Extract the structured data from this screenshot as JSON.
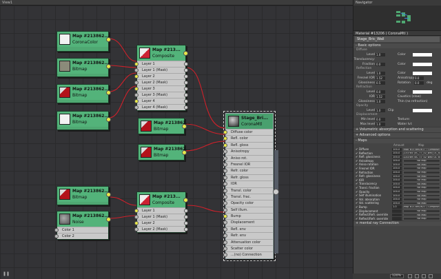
{
  "window": {
    "title": "View1"
  },
  "colors": {
    "node_bg": "#4fa872",
    "slot_bg": "#c9c9c9",
    "wire": "#d0202a",
    "port": "#e8e84a",
    "canvas": "#333336",
    "panel": "#444444"
  },
  "nodes": {
    "map_cc": {
      "name": "Map #213862...",
      "type": "CoronaColor"
    },
    "map_bmp1": {
      "name": "Map #213862...",
      "type": "Bitmap"
    },
    "map_bmp2": {
      "name": "Map #213862...",
      "type": "Bitmap"
    },
    "map_bmp3": {
      "name": "Map #213862...",
      "type": "Bitmap"
    },
    "composite1": {
      "name": "Map #213...",
      "type": "Composite",
      "slots": [
        "Layer 1",
        "Layer 1 (Mask)",
        "Layer 2",
        "Layer 2 (Mask)",
        "Layer 3",
        "Layer 3 (Mask)",
        "Layer 4",
        "Layer 4 (Mask)"
      ]
    },
    "map_bmp4": {
      "name": "Map #213862...",
      "type": "Bitmap"
    },
    "map_bmp5": {
      "name": "Map #213862...",
      "type": "Bitmap"
    },
    "material": {
      "name": "Stage_Bri...",
      "type": "CoronaMtl",
      "slots": [
        "Diffuse color",
        "Refl. color",
        "Refl. gloss",
        "Anisotropy",
        "Aniso rot.",
        "Fresnel IOR",
        "Refr. color",
        "Refr. gloss",
        "IOR",
        "Transl. color",
        "Transl. frac.",
        "Opacity color",
        "Self illum.",
        "Bump",
        "Displacement",
        "Refl. env",
        "Refr. env",
        "Attenuation color",
        "Scatter color",
        "...(no) Connection"
      ]
    },
    "map_bmp6": {
      "name": "Map #213862...",
      "type": "Bitmap"
    },
    "noise": {
      "name": "Map #213862...",
      "type": "Noise",
      "slots": [
        "Color 1",
        "Color 2"
      ]
    },
    "composite2": {
      "name": "Map #213...",
      "type": "Composite",
      "slots": [
        "Layer 1",
        "Layer 1 (Mask)",
        "Layer 2",
        "Layer 2 (Mask)"
      ]
    }
  },
  "navigator": {
    "title": "Navigator"
  },
  "params": {
    "title": "Material #13206  ( CoronaMtl )",
    "mat_name": "Stage_Bric_Wall",
    "basic_options": "Basic options",
    "diffuse": {
      "label": "Diffuse",
      "level_lbl": "Level",
      "level": "1.0",
      "color_lbl": "Color",
      "transl_lbl": "Translucency:",
      "fraction_lbl": "Fraction",
      "fraction": "0.0"
    },
    "reflection": {
      "label": "Reflection",
      "level": "1.0",
      "level_lbl": "Level",
      "fresnel_lbl": "Fresnel IOR",
      "fresnel": "1.52",
      "aniso_lbl": "Anisotropy",
      "aniso": "0.0",
      "gloss_lbl": "Glossiness",
      "gloss": "0.5",
      "rot_lbl": "Rotation",
      "rot": "0.0",
      "deg": "deg",
      "color_lbl": "Color"
    },
    "refraction": {
      "label": "Refraction",
      "level": "0.0",
      "level_lbl": "Level",
      "ior_lbl": "IOR",
      "ior": "1.52",
      "color_lbl": "Color",
      "caustics": "Caustics (slow)",
      "gloss_lbl": "Glossiness",
      "gloss": "1.0",
      "thin": "Thin (no refraction)"
    },
    "opacity": {
      "label": "Opacity",
      "level": "1.0",
      "level_lbl": "Level",
      "clip": "Clip",
      "color_lbl": "Color"
    },
    "displacement": {
      "label": "Displacement",
      "min_lbl": "Min level",
      "min": "0.0",
      "max_lbl": "Max level",
      "max": "1.0",
      "tex_lbl": "Texture:",
      "water_lbl": "Water lvl:"
    },
    "volumetric": "Volumetric absorption and scattering",
    "advanced": "Advanced options",
    "maps_title": "Maps",
    "maps_cols": {
      "amount": "Amount",
      "map": "Map"
    },
    "maps": [
      {
        "name": "Diffuse",
        "amount": "100.0",
        "map": "Map #213862617 ( Composite )"
      },
      {
        "name": "Reflection",
        "amount": "100.0",
        "map": "220784 (0C_77_02_wall_01_d1.jpg)"
      },
      {
        "name": "Refl. glossiness",
        "amount": "100.0",
        "map": "220789 (0C_77_02_wall_01_d1.jpg)"
      },
      {
        "name": "Anisotropy",
        "amount": "100.0",
        "map": "No Map"
      },
      {
        "name": "Aniso rotation",
        "amount": "100.0",
        "map": "No Map"
      },
      {
        "name": "Fresnel IOR",
        "amount": "100.0",
        "map": "No Map"
      },
      {
        "name": "Refraction",
        "amount": "100.0",
        "map": "No Map"
      },
      {
        "name": "Refr. glossiness",
        "amount": "100.0",
        "map": "No Map"
      },
      {
        "name": "IOR",
        "amount": "100.0",
        "map": "No Map"
      },
      {
        "name": "Translucency",
        "amount": "100.0",
        "map": "No Map"
      },
      {
        "name": "Transl. fraction",
        "amount": "100.0",
        "map": "No Map"
      },
      {
        "name": "Opacity",
        "amount": "100.0",
        "map": "No Map"
      },
      {
        "name": "Self illumination",
        "amount": "100.0",
        "map": "No Map"
      },
      {
        "name": "Vol. absorption",
        "amount": "100.0",
        "map": "No Map"
      },
      {
        "name": "Vol. scattering",
        "amount": "100.0",
        "map": "No Map"
      },
      {
        "name": "Bump",
        "amount": "1.0",
        "map": "Map #213862621 ( Composite )"
      },
      {
        "name": "Displacement",
        "amount": "",
        "map": "No Map"
      },
      {
        "name": "Reflect/Refr. override",
        "amount": "",
        "map": "No Map"
      },
      {
        "name": "Reflect/Refr. override",
        "amount": "",
        "map": "No Map"
      }
    ],
    "mental_ray": "mental ray Connection"
  },
  "status": {
    "zoom": "120%"
  }
}
